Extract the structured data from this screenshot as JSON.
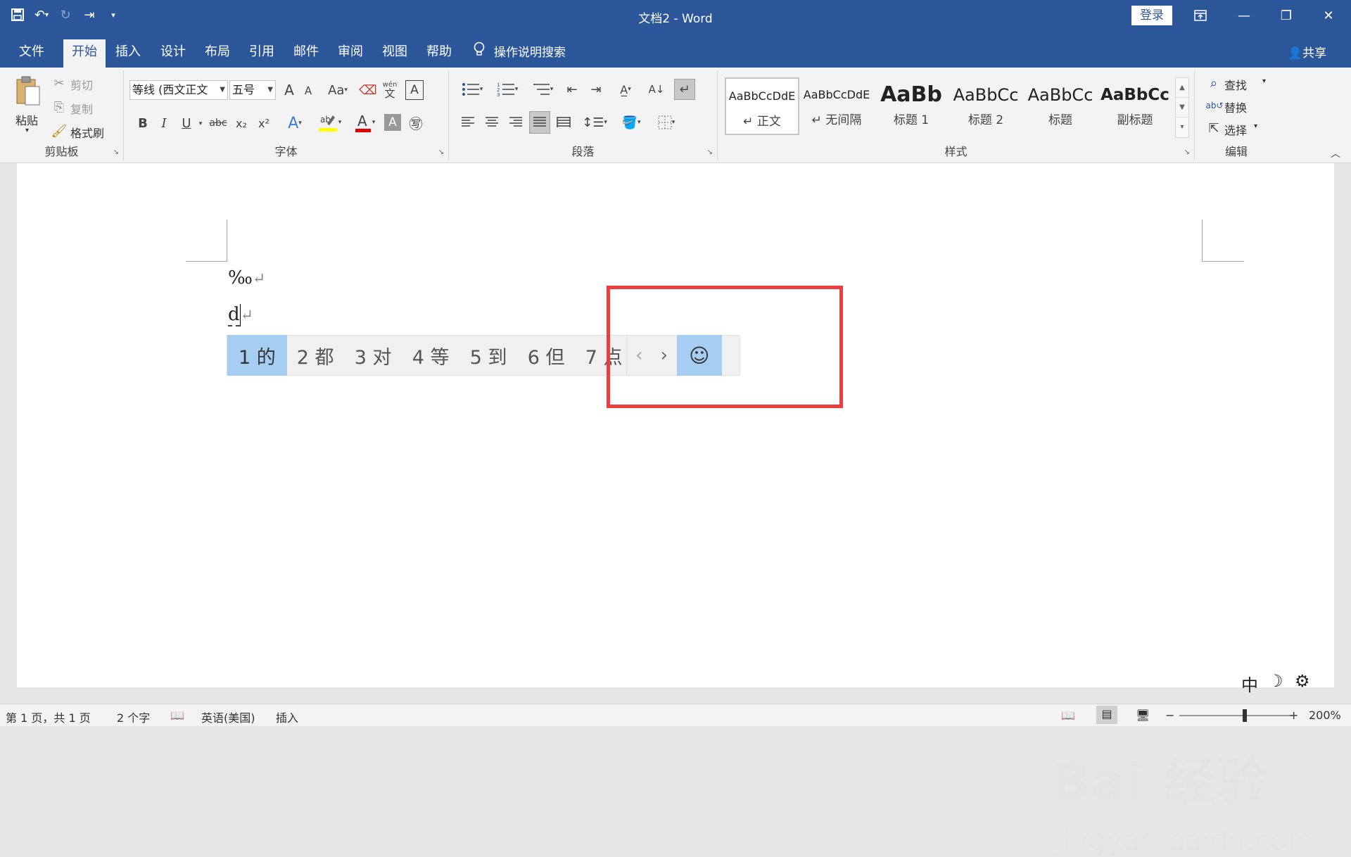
{
  "window": {
    "title": "文档2  -  Word",
    "login": "登录",
    "share": "共享"
  },
  "qat": {
    "save_icon": "save-icon",
    "undo_icon": "undo-icon",
    "redo_icon": "redo-icon",
    "indent_icon": "indent-icon",
    "customize_icon": "customize-icon"
  },
  "tabs": [
    "文件",
    "开始",
    "插入",
    "设计",
    "布局",
    "引用",
    "邮件",
    "审阅",
    "视图",
    "帮助"
  ],
  "tellme": "操作说明搜索",
  "clipboard": {
    "paste": "粘贴",
    "cut": "剪切",
    "copy": "复制",
    "format_painter": "格式刷",
    "label": "剪贴板"
  },
  "font": {
    "name": "等线 (西文正文",
    "size": "五号",
    "label": "字体",
    "grow": "A",
    "shrink": "A",
    "case": "Aa",
    "bold": "B",
    "italic": "I",
    "underline": "U",
    "strike": "abc",
    "sub": "x₂",
    "sup": "x²",
    "phonetic_top": "wén",
    "phonetic_bottom": "文",
    "border_char": "A",
    "shade_char": "A",
    "enclose_char": "㊢"
  },
  "paragraph": {
    "label": "段落"
  },
  "styles": {
    "label": "样式",
    "items": [
      {
        "preview": "AaBbCcDdE",
        "name": "↵ 正文"
      },
      {
        "preview": "AaBbCcDdE",
        "name": "↵ 无间隔"
      },
      {
        "preview": "AaBb",
        "name": "标题 1"
      },
      {
        "preview": "AaBbCc",
        "name": "标题 2"
      },
      {
        "preview": "AaBbCc",
        "name": "标题"
      },
      {
        "preview": "AaBbCc",
        "name": "副标题"
      }
    ]
  },
  "editing": {
    "find": "查找",
    "replace": "替换",
    "select": "选择",
    "label": "编辑"
  },
  "document": {
    "line1": "‰",
    "line2": "d"
  },
  "ime": {
    "candidates": [
      "1 的",
      "2 都",
      "3 对",
      "4 等",
      "5 到",
      "6 但",
      "7 点"
    ],
    "prev": "‹",
    "next": "›",
    "emoji": "☺"
  },
  "status": {
    "page": "第 1 页，共 1 页",
    "words": "2 个字",
    "language": "英语(美国)",
    "mode": "插入",
    "zoom": "200%",
    "zoom_minus": "−",
    "zoom_plus": "+"
  },
  "watermark": {
    "line1": "Bai 经验",
    "line2": "jingyan.baidu.com"
  },
  "colors": {
    "accent": "#2b579a",
    "ime_highlight": "#a5cef2",
    "annotation_box": "#ed3d3d"
  }
}
